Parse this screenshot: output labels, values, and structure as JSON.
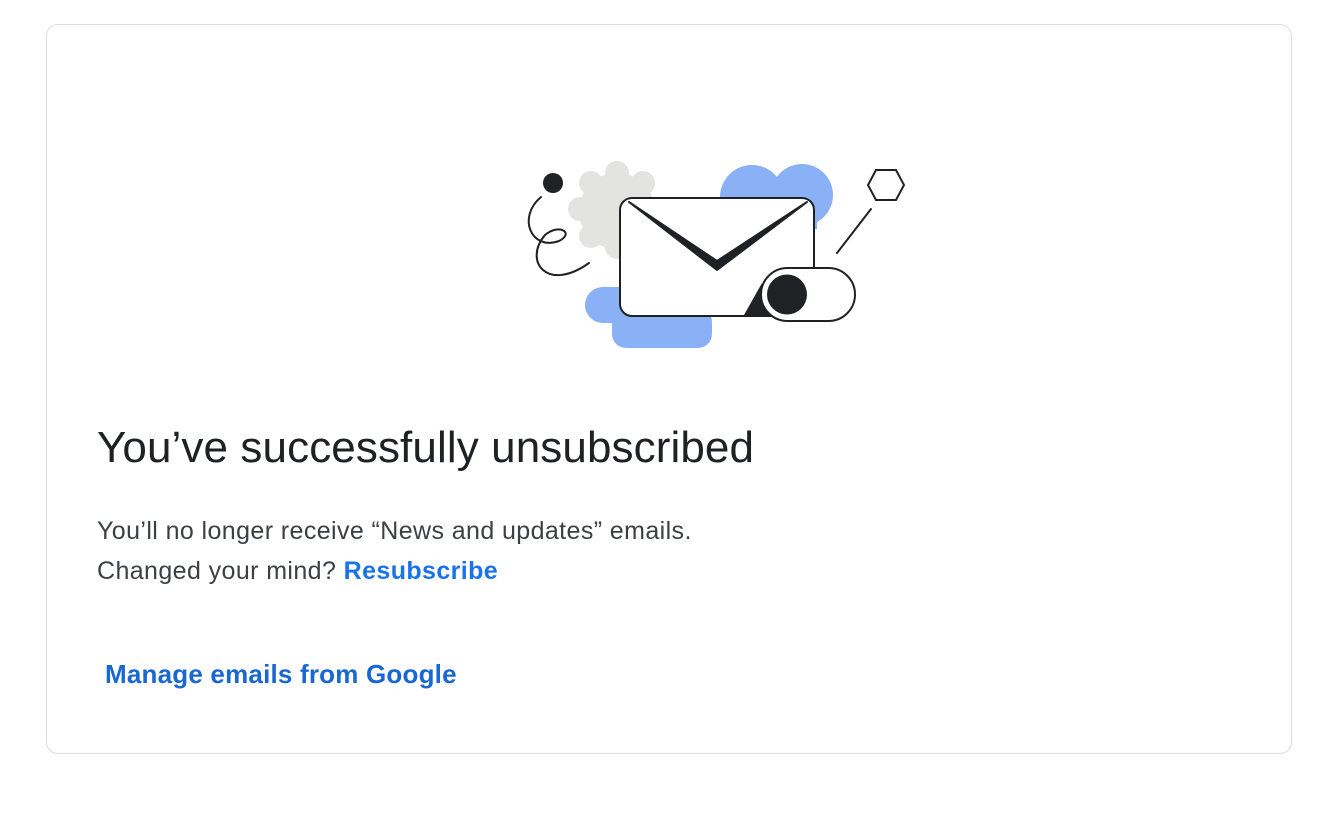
{
  "page": {
    "title": "You’ve successfully unsubscribed",
    "message_line1": "You’ll no longer receive “News and updates” emails.",
    "message_line2_prefix": "Changed your mind?",
    "resubscribe_label": "Resubscribe",
    "manage_label": "Manage emails from Google"
  },
  "colors": {
    "accent_link": "#1a73e8",
    "manage_link": "#1967d2",
    "title_text": "#202124",
    "body_text": "#3c4043",
    "card_border": "#dadce0",
    "illustration_blue": "#8ab0f5",
    "illustration_gray": "#e3e4e2"
  },
  "illustration": {
    "icon": "envelope-toggle-illustration"
  }
}
